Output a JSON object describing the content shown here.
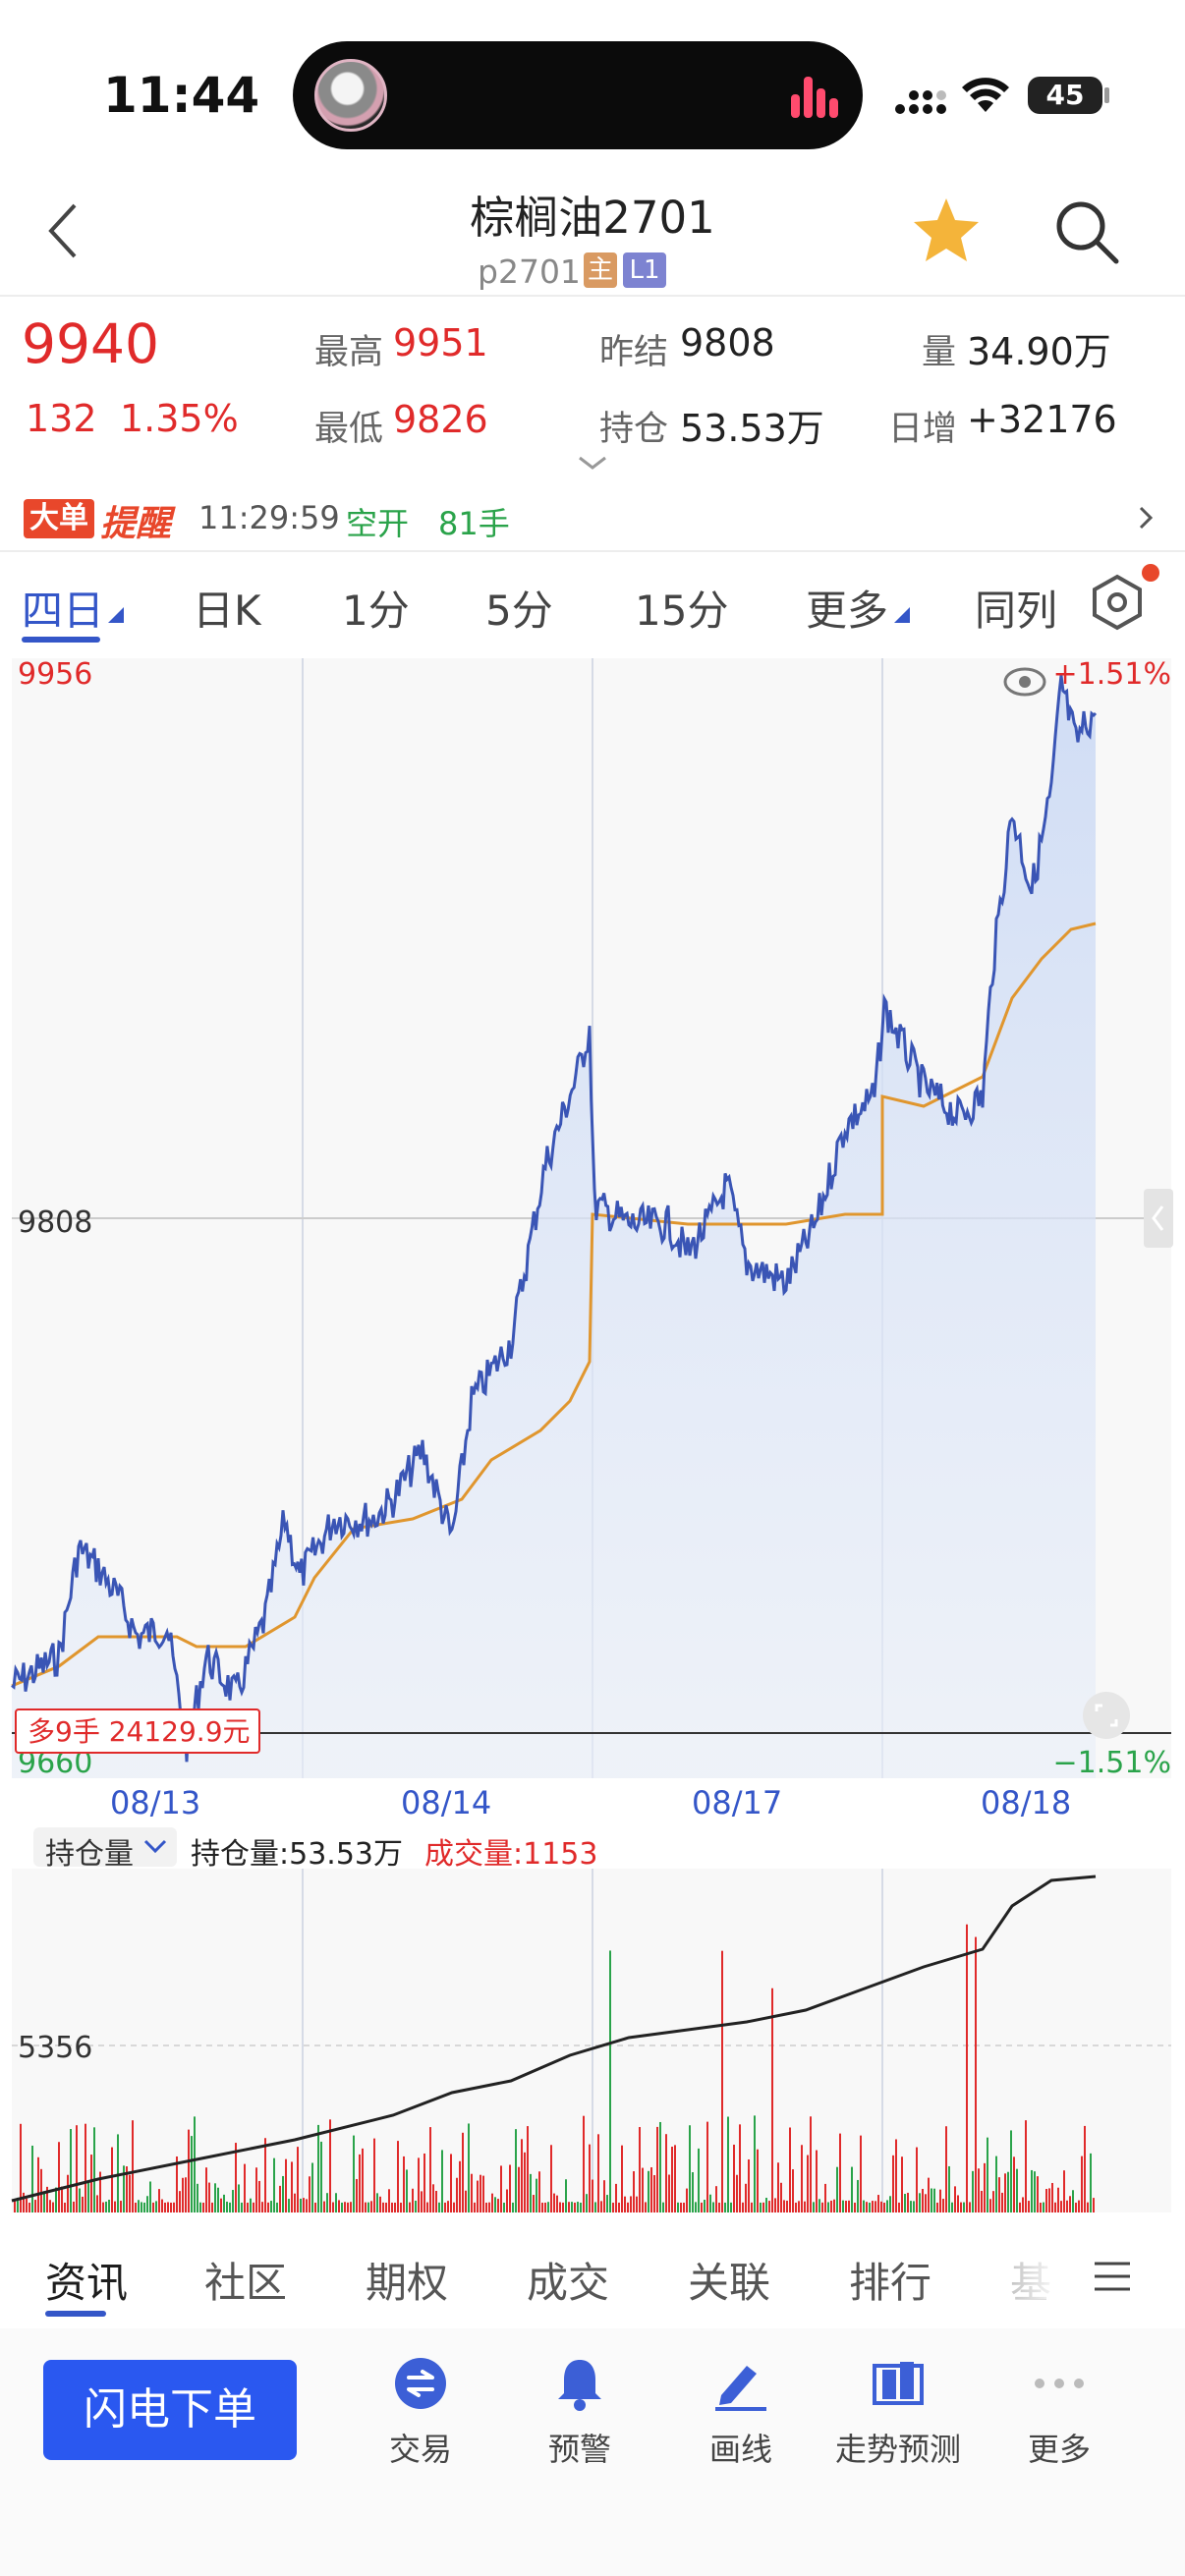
{
  "status_bar": {
    "time": "11:44",
    "battery": "45"
  },
  "header": {
    "title": "棕榈油2701",
    "code": "p2701",
    "tag_main": "主",
    "tag_level": "L1"
  },
  "quote": {
    "last": "9940",
    "change": "132",
    "change_pct": "1.35%",
    "high_label": "最高",
    "high": "9951",
    "low_label": "最低",
    "low": "9826",
    "prev_settle_label": "昨结",
    "prev_settle": "9808",
    "oi_label": "持仓",
    "oi": "53.53万",
    "volume_label": "量",
    "volume": "34.90万",
    "daily_inc_label": "日增",
    "daily_inc": "+32176"
  },
  "alert": {
    "badge": "大单",
    "title": "提醒",
    "time": "11:29:59",
    "action": "空开",
    "lots": "81手"
  },
  "period_tabs": [
    "四日",
    "日K",
    "1分",
    "5分",
    "15分",
    "更多",
    "同列"
  ],
  "price_chart": {
    "top_label": "9956",
    "mid_label": "9808",
    "bottom_label": "9660",
    "top_pct": "+1.51%",
    "bottom_pct": "−1.51%",
    "position_tag": "多9手 24129.9元",
    "dates": [
      "08/13",
      "08/14",
      "08/17",
      "08/18"
    ],
    "colors": {
      "price": "#3a55b5",
      "avg": "#e0962e",
      "up": "#e02a2a",
      "down": "#2aa34a"
    }
  },
  "volume_chart": {
    "selector": "持仓量",
    "oi_text": "持仓量:53.53万",
    "vol_text": "成交量:1153",
    "level_label": "5356"
  },
  "bottom_tabs": [
    "资讯",
    "社区",
    "期权",
    "成交",
    "关联",
    "排行",
    "基"
  ],
  "actions": {
    "flash_order": "闪电下单",
    "items": [
      "交易",
      "预警",
      "画线",
      "走势预测",
      "更多"
    ]
  },
  "chart_data": {
    "type": "line",
    "x": [
      "08/13",
      "08/14",
      "08/17",
      "08/18"
    ],
    "ylim": [
      9660,
      9956
    ],
    "series": [],
    "reference_line": 9808
  }
}
